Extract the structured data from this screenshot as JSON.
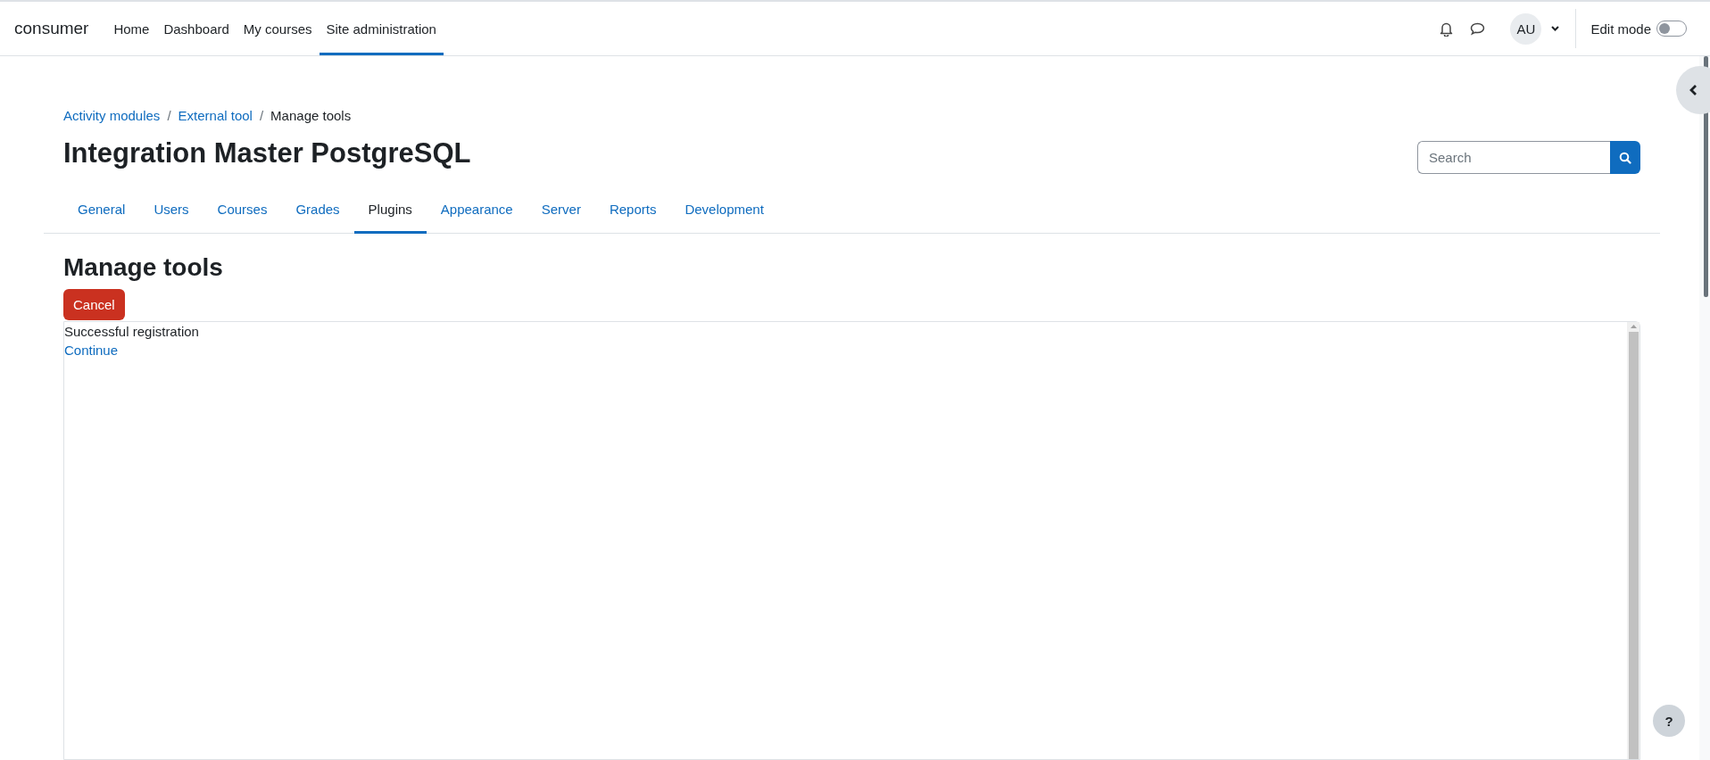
{
  "navbar": {
    "brand": "consumer",
    "items": [
      {
        "label": "Home",
        "selected": false
      },
      {
        "label": "Dashboard",
        "selected": false
      },
      {
        "label": "My courses",
        "selected": false
      },
      {
        "label": "Site administration",
        "selected": true
      }
    ],
    "avatar": "AU",
    "edit_mode": {
      "label": "Edit mode",
      "on": false
    }
  },
  "breadcrumb": [
    {
      "label": "Activity modules",
      "link": true
    },
    {
      "separator": "/",
      "label": "External tool",
      "link": true
    },
    {
      "separator": "/",
      "label": "Manage tools",
      "link": false
    }
  ],
  "title": "Integration Master PostgreSQL",
  "search": {
    "placeholder": "Search"
  },
  "tabs": [
    {
      "label": "General",
      "selected": false
    },
    {
      "label": "Users",
      "selected": false
    },
    {
      "label": "Courses",
      "selected": false
    },
    {
      "label": "Grades",
      "selected": false
    },
    {
      "label": "Plugins",
      "selected": true
    },
    {
      "label": "Appearance",
      "selected": false
    },
    {
      "label": "Server",
      "selected": false
    },
    {
      "label": "Reports",
      "selected": false
    },
    {
      "label": "Development",
      "selected": false
    }
  ],
  "heading": "Manage tools",
  "cancel_button": "Cancel",
  "frame": {
    "message": "Successful registration",
    "link": "Continue"
  },
  "help_button": "?"
}
